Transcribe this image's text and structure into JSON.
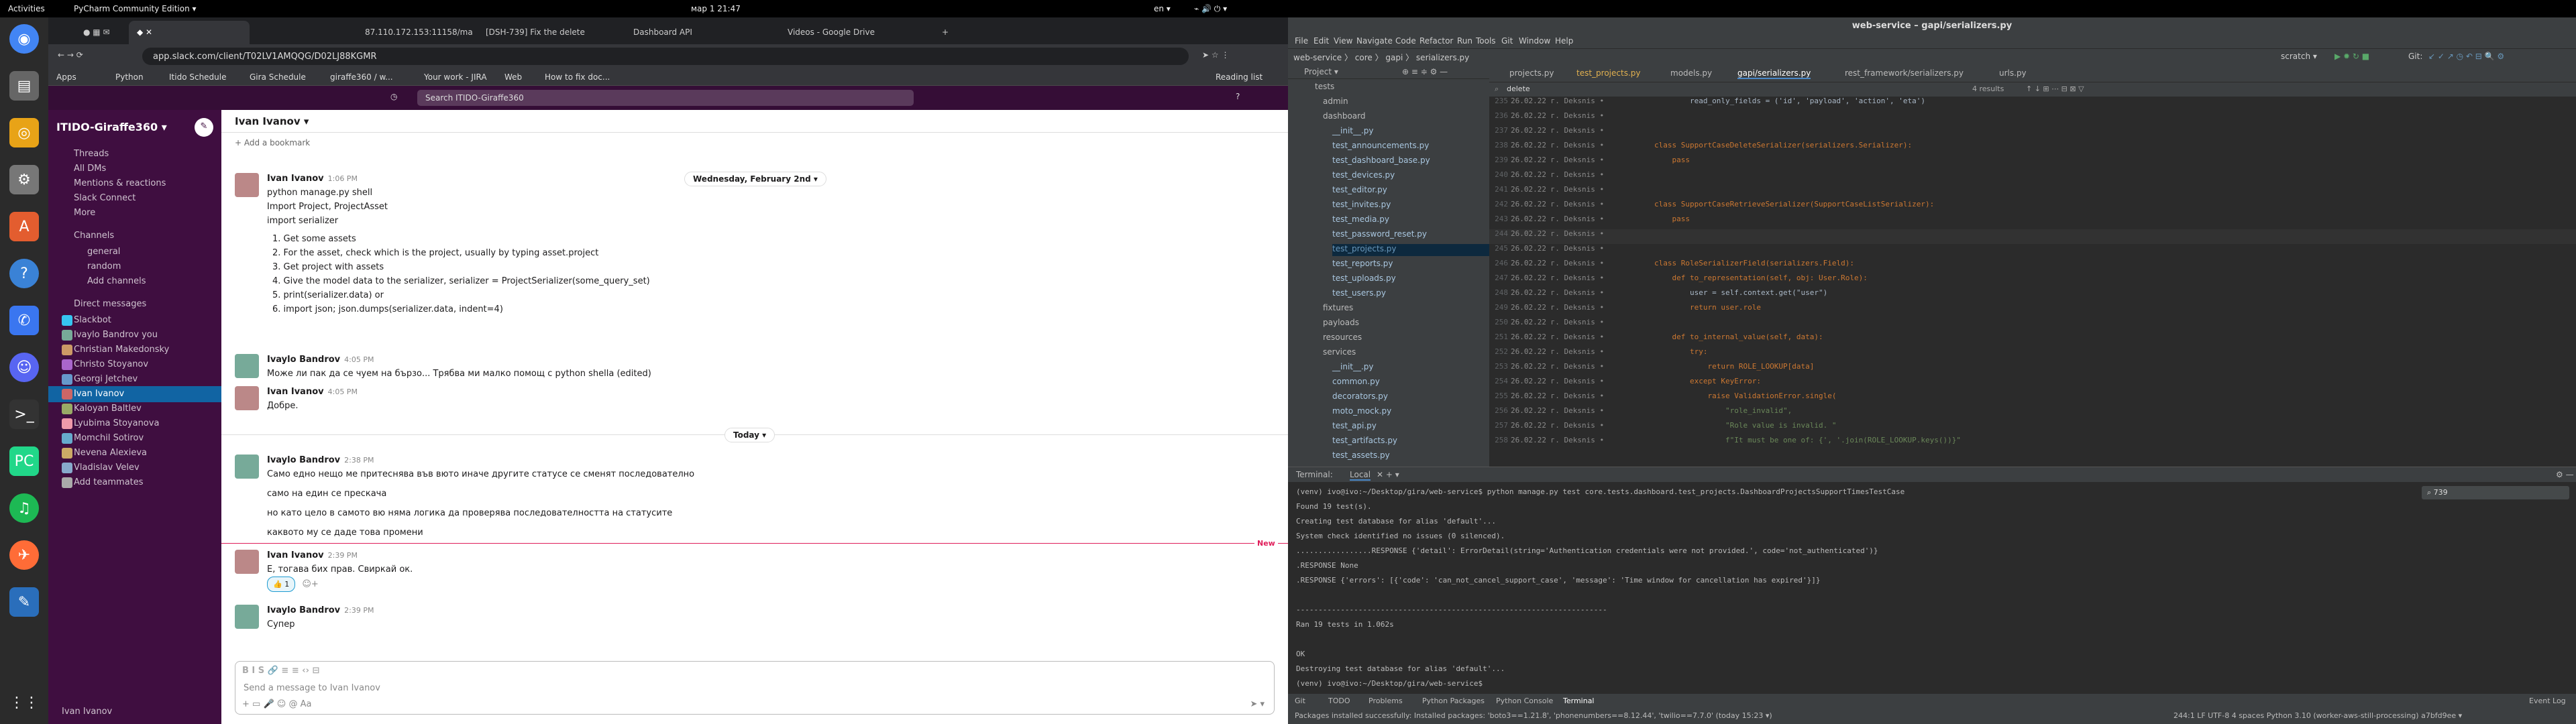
{
  "topbar": {
    "activities": "Activities",
    "app": "PyCharm Community Edition ▾",
    "clock": "мар 1  21:47",
    "lang": "en ▾"
  },
  "dock": {
    "icons": [
      "chrome-icon",
      "files-icon",
      "rhythmbox-icon",
      "settings-icon",
      "libreoffice-icon",
      "help-icon",
      "signal-icon",
      "discord-icon",
      "terminal-icon",
      "pycharm-icon",
      "spotify-icon",
      "postman-icon",
      "editor-icon",
      "grid-icon"
    ]
  },
  "browser": {
    "tabs": [
      "",
      "",
      "87.110.172.153:11158/ma",
      "[DSH-739] Fix the delete",
      "Dashboard API",
      "Videos - Google Drive"
    ],
    "url": "app.slack.com/client/T02LV1AMQQG/D02LJ88KGMR",
    "bookmarks": [
      "Apps",
      "Python",
      "Itido Schedule",
      "Gira Schedule",
      "giraffe360 / w...",
      "Your work - JIRA",
      "Web",
      "How to fix doc...",
      "Reading list"
    ]
  },
  "slack": {
    "search": "Search ITIDO-Giraffe360",
    "workspace": "ITIDO-Giraffe360 ▾",
    "nav": [
      "Threads",
      "All DMs",
      "Mentions & reactions",
      "Slack Connect",
      "More"
    ],
    "channels_header": "Channels",
    "channels": [
      "general",
      "random",
      "Add channels"
    ],
    "dm_header": "Direct messages",
    "dms": [
      "Slackbot",
      "Ivaylo Bandrov  you",
      "Christian Makedonsky",
      "Christo Stoyanov",
      "Georgi Jetchev",
      "Ivan Ivanov",
      "Kaloyan Baltlev",
      "Lyubima Stoyanova",
      "Momchil Sotirov",
      "Nevena Alexieva",
      "Vladislav Velev",
      "Add teammates"
    ],
    "footer": "Ivan Ivanov",
    "header": "Ivan Ivanov ▾",
    "bookmark": "+ Add a bookmark",
    "date1": "Wednesday, February 2nd ▾",
    "date2": "Today ▾",
    "new_label": "New",
    "messages": [
      {
        "name": "Ivan Ivanov",
        "time": "1:06 PM",
        "lines": [
          "python manage.py shell",
          "Import Project, ProjectAsset",
          "import serializer"
        ]
      },
      {
        "list": [
          "1.   Get some assets",
          "2.   For the asset, check which is the project, usually by typing asset.project",
          "3.   Get project with assets",
          "4.   Give the model data to the serializer, serializer = ProjectSerializer(some_query_set)",
          "5.   print(serializer.data) or",
          "6.   import json; json.dumps(serializer.data, indent=4)"
        ]
      },
      {
        "name": "Ivaylo Bandrov",
        "time": "4:05 PM",
        "lines": [
          "Може ли пак да се чуем на бързо... Трябва ми малко помощ с python shella (edited)"
        ]
      },
      {
        "name": "Ivan Ivanov",
        "time": "4:05 PM",
        "lines": [
          "Добре."
        ]
      },
      {
        "name": "Ivaylo Bandrov",
        "time": "2:38 PM",
        "lines": [
          "Само едно нещо ме притеснява във вюто иначе другите статусе се сменят последователно",
          "само на един се прескача",
          "но като цело в самото вю няма логика да проверява последователността на статусите",
          "каквото му се даде това промени"
        ]
      },
      {
        "name": "Ivan Ivanov",
        "time": "2:39 PM",
        "lines": [
          "Е, тогава бих прав. Свиркай ок."
        ]
      },
      {
        "name": "Ivaylo Bandrov",
        "time": "2:39 PM",
        "lines": [
          "Супер"
        ]
      }
    ],
    "reaction": "👍 1",
    "composer_placeholder": "Send a message to Ivan Ivanov"
  },
  "ide": {
    "title": "web-service – gapi/serializers.py",
    "menu": [
      "File",
      "Edit",
      "View",
      "Navigate",
      "Code",
      "Refactor",
      "Run",
      "Tools",
      "Git",
      "Window",
      "Help"
    ],
    "breadcrumb": "web-service  〉 core 〉 gapi 〉 serializers.py",
    "run_config": "scratch ▾",
    "git": "Git:",
    "project_label": "Project ▾",
    "search_value": "delete",
    "search_results": "4 results",
    "tabs": [
      "projects.py",
      "test_projects.py",
      "models.py",
      "gapi/serializers.py",
      "rest_framework/serializers.py",
      "urls.py"
    ],
    "tree": [
      "tests",
      "admin",
      "dashboard",
      "__init__.py",
      "test_announcements.py",
      "test_dashboard_base.py",
      "test_devices.py",
      "test_editor.py",
      "test_invites.py",
      "test_media.py",
      "test_password_reset.py",
      "test_projects.py",
      "test_reports.py",
      "test_uploads.py",
      "test_users.py",
      "fixtures",
      "payloads",
      "resources",
      "services",
      "__init__.py",
      "common.py",
      "decorators.py",
      "moto_mock.py",
      "test_api.py",
      "test_artifacts.py",
      "test_assets.py"
    ],
    "code": [
      {
        "n": "235",
        "b": "26.02.22 г. Deksnis •",
        "c": "        read_only_fields = ('id', 'payload', 'action', 'eta')"
      },
      {
        "n": "236",
        "b": "26.02.22 г. Deksnis •",
        "c": ""
      },
      {
        "n": "237",
        "b": "26.02.22 г. Deksnis •",
        "c": ""
      },
      {
        "n": "238",
        "b": "26.02.22 г. Deksnis •",
        "c": "class SupportCaseDeleteSerializer(serializers.Serializer):"
      },
      {
        "n": "239",
        "b": "26.02.22 г. Deksnis •",
        "c": "    pass"
      },
      {
        "n": "240",
        "b": "26.02.22 г. Deksnis •",
        "c": ""
      },
      {
        "n": "241",
        "b": "26.02.22 г. Deksnis •",
        "c": ""
      },
      {
        "n": "242",
        "b": "26.02.22 г. Deksnis •",
        "c": "class SupportCaseRetrieveSerializer(SupportCaseListSerializer):"
      },
      {
        "n": "243",
        "b": "26.02.22 г. Deksnis •",
        "c": "    pass"
      },
      {
        "n": "244",
        "b": "26.02.22 г. Deksnis •",
        "c": ""
      },
      {
        "n": "245",
        "b": "26.02.22 г. Deksnis •",
        "c": ""
      },
      {
        "n": "246",
        "b": "26.02.22 г. Deksnis •",
        "c": "class RoleSerializerField(serializers.Field):"
      },
      {
        "n": "247",
        "b": "26.02.22 г. Deksnis •",
        "c": "    def to_representation(self, obj: User.Role):"
      },
      {
        "n": "248",
        "b": "26.02.22 г. Deksnis •",
        "c": "        user = self.context.get(\"user\")"
      },
      {
        "n": "249",
        "b": "26.02.22 г. Deksnis •",
        "c": "        return user.role"
      },
      {
        "n": "250",
        "b": "26.02.22 г. Deksnis •",
        "c": ""
      },
      {
        "n": "251",
        "b": "26.02.22 г. Deksnis •",
        "c": "    def to_internal_value(self, data):"
      },
      {
        "n": "252",
        "b": "26.02.22 г. Deksnis •",
        "c": "        try:"
      },
      {
        "n": "253",
        "b": "26.02.22 г. Deksnis •",
        "c": "            return ROLE_LOOKUP[data]"
      },
      {
        "n": "254",
        "b": "26.02.22 г. Deksnis •",
        "c": "        except KeyError:"
      },
      {
        "n": "255",
        "b": "26.02.22 г. Deksnis •",
        "c": "            raise ValidationError.single("
      },
      {
        "n": "256",
        "b": "26.02.22 г. Deksnis •",
        "c": "                \"role_invalid\","
      },
      {
        "n": "257",
        "b": "26.02.22 г. Deksnis •",
        "c": "                \"Role value is invalid. \""
      },
      {
        "n": "258",
        "b": "26.02.22 г. Deksnis •",
        "c": "                f\"It must be one of: {', '.join(ROLE_LOOKUP.keys())}\""
      }
    ],
    "terminal_label": "Terminal:",
    "terminal_tab": "Local",
    "terminal_search": "739",
    "terminal": [
      "(venv) ivo@ivo:~/Desktop/gira/web-service$ python manage.py test core.tests.dashboard.test_projects.DashboardProjectsSupportTimesTestCase",
      "Found 19 test(s).",
      "Creating test database for alias 'default'...",
      "System check identified no issues (0 silenced).",
      ".................RESPONSE {'detail': ErrorDetail(string='Authentication credentials were not provided.', code='not_authenticated')}",
      ".RESPONSE None",
      ".RESPONSE {'errors': [{'code': 'can_not_cancel_support_case', 'message': 'Time window for cancellation has expired'}]}",
      "",
      "----------------------------------------------------------------------",
      "Ran 19 tests in 1.062s",
      "",
      "OK",
      "Destroying test database for alias 'default'...",
      "(venv) ivo@ivo:~/Desktop/gira/web-service$ "
    ],
    "bottom_tabs": [
      "Git",
      "TODO",
      "Problems",
      "Python Packages",
      "Python Console",
      "Terminal",
      "Event Log"
    ],
    "status_left": "Packages installed successfully: Installed packages: 'boto3==1.21.8', 'phonenumbers==8.12.44', 'twilio==7.7.0' (today 15:23 ▾)",
    "status_right": "244:1   LF   UTF-8   4 spaces   Python 3.10 (worker-aws-still-processing)   a7bfd9ee ▾"
  }
}
